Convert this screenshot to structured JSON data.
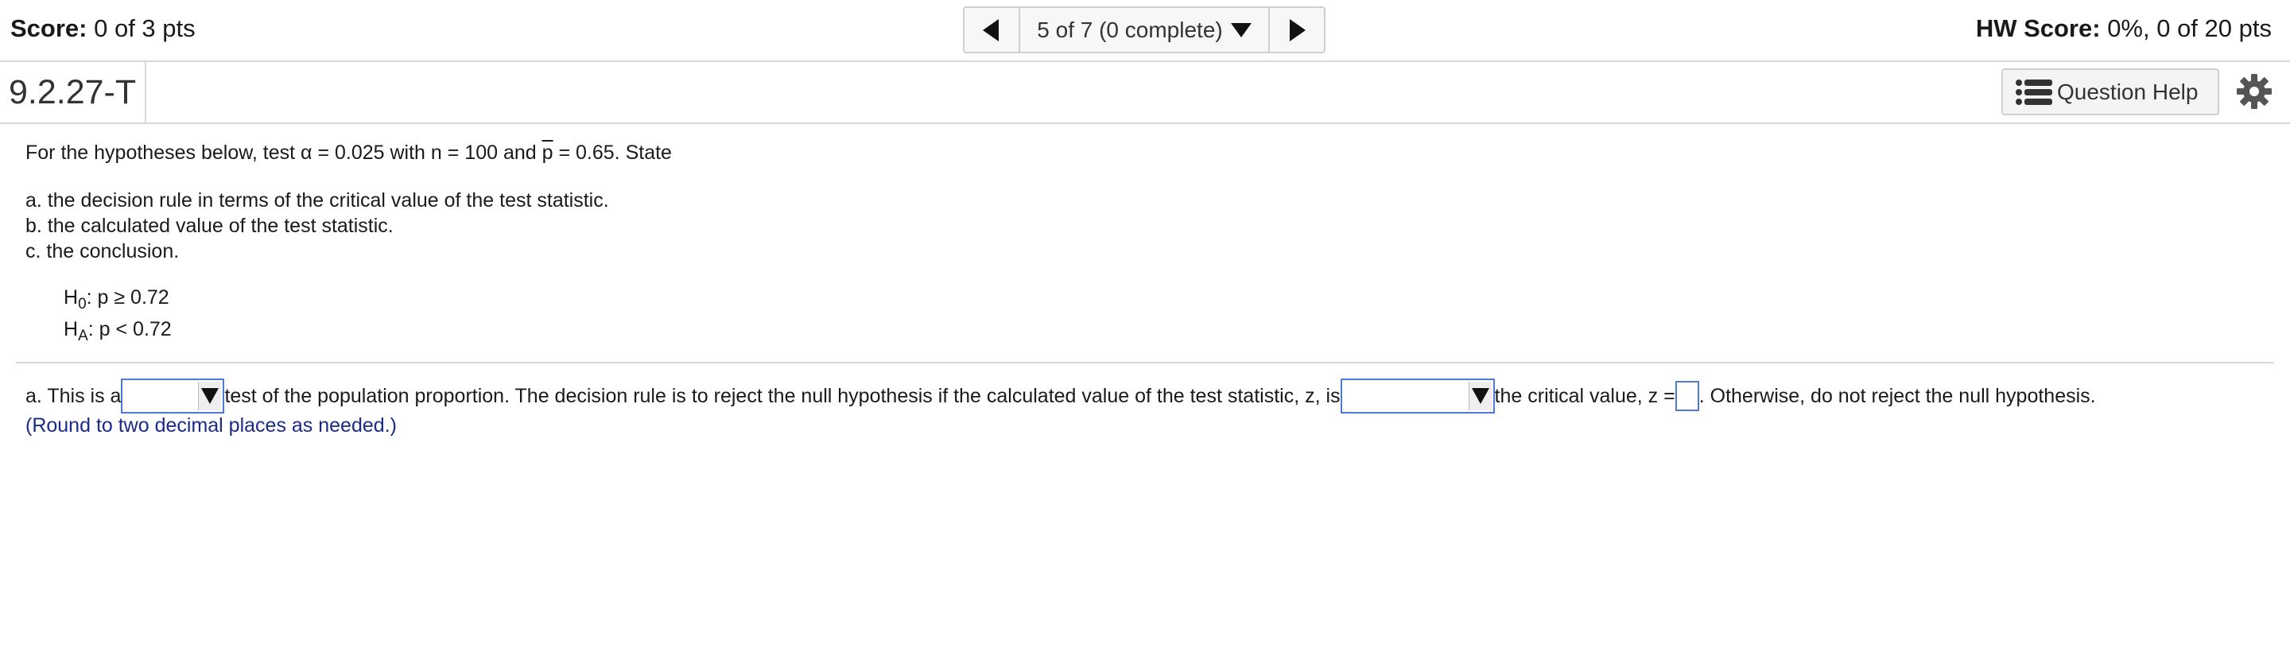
{
  "topbar": {
    "score_label": "Score:",
    "score_value": "0 of 3 pts",
    "nav_label": "5 of 7 (0 complete)",
    "hw_label": "HW Score:",
    "hw_value": "0%, 0 of 20 pts",
    "icons": [
      "prev-arrow-icon",
      "chevron-down-icon",
      "next-arrow-icon"
    ]
  },
  "header": {
    "question_id": "9.2.27-T",
    "help_label": "Question Help",
    "icons": [
      "list-icon",
      "gear-icon"
    ]
  },
  "problem": {
    "intro_a": "For the hypotheses below, test ",
    "alpha_symbol": "α",
    "intro_b": " = 0.025 with n = 100 and ",
    "pbar_symbol": "p",
    "intro_c": " = 0.65. State",
    "items": [
      "a. the decision rule in terms of the critical value of the test statistic.",
      "b. the calculated value of the test statistic.",
      "c. the conclusion."
    ],
    "h0_letter": "H",
    "h0_sub": "0",
    "h0_expr": ": p ≥ 0.72",
    "ha_letter": "H",
    "ha_sub": "A",
    "ha_expr": ": p < 0.72"
  },
  "answer": {
    "prefix": "a. This is a ",
    "middle": " test of the population proportion. The decision rule is to reject the null hypothesis if the calculated value of the test statistic, z, is ",
    "crit_text": " the critical value, z = ",
    "suffix": ". Otherwise, do not reject the null hypothesis.",
    "dropdown_1_value": "",
    "dropdown_2_value": "",
    "z_value": "",
    "hint": "(Round to two decimal places as needed.)"
  }
}
